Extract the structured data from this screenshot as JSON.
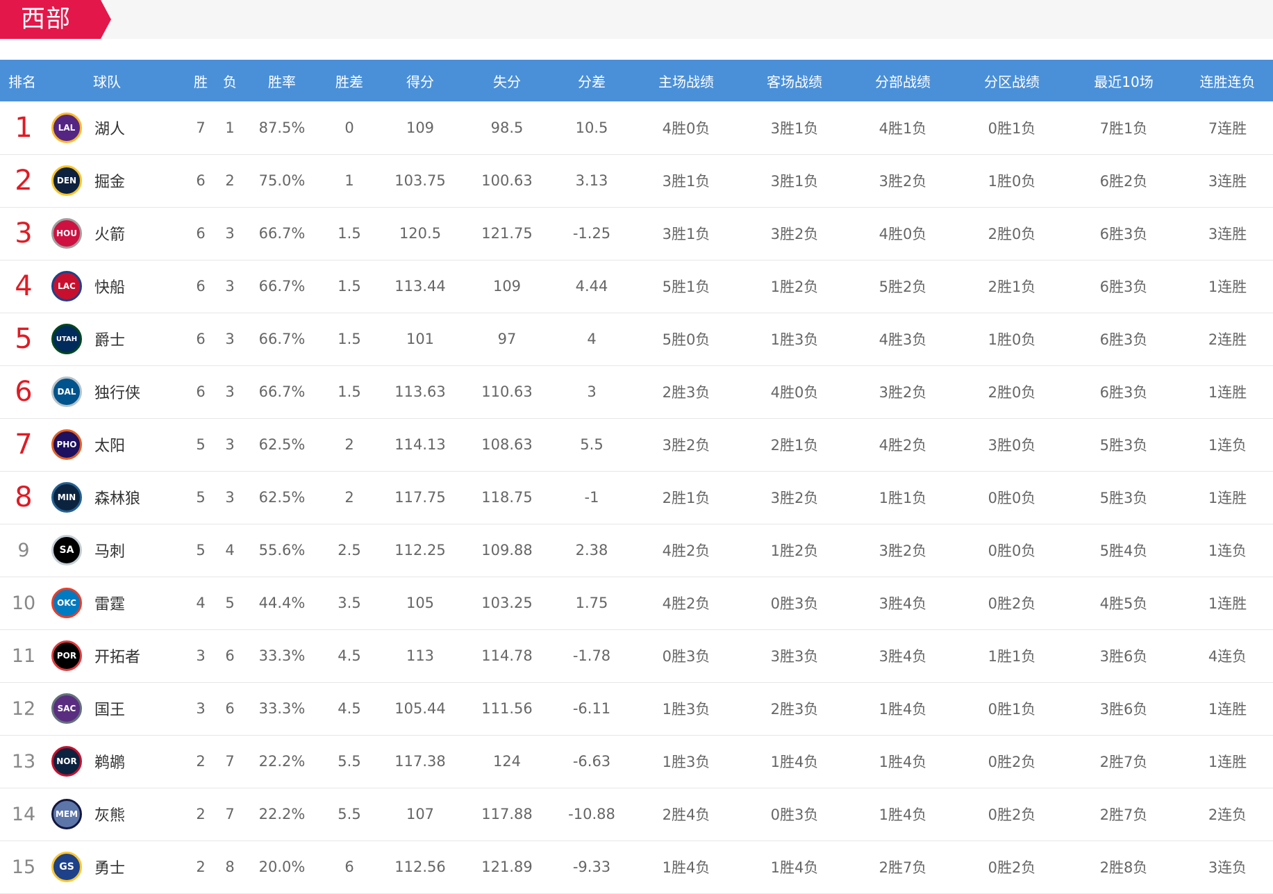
{
  "conference": {
    "label": "西部",
    "accent_color": "#e4174a"
  },
  "header_color": "#4a90d9",
  "columns": [
    "排名",
    "球队",
    "胜",
    "负",
    "胜率",
    "胜差",
    "得分",
    "失分",
    "分差",
    "主场战绩",
    "客场战绩",
    "分部战绩",
    "分区战绩",
    "最近10场",
    "连胜连负"
  ],
  "teams": [
    {
      "rank": "1",
      "logo": "LAL",
      "logo_color": "#552583",
      "logo_ring": "#fdb927",
      "name": "湖人",
      "w": "7",
      "l": "1",
      "pct": "87.5%",
      "gb": "0",
      "pf": "109",
      "pa": "98.5",
      "diff": "10.5",
      "home": "4胜0负",
      "away": "3胜1负",
      "div": "4胜1负",
      "conf": "0胜1负",
      "last10": "7胜1负",
      "streak": "7连胜"
    },
    {
      "rank": "2",
      "logo": "DEN",
      "logo_color": "#0e2240",
      "logo_ring": "#fec524",
      "name": "掘金",
      "w": "6",
      "l": "2",
      "pct": "75.0%",
      "gb": "1",
      "pf": "103.75",
      "pa": "100.63",
      "diff": "3.13",
      "home": "3胜1负",
      "away": "3胜1负",
      "div": "3胜2负",
      "conf": "1胜0负",
      "last10": "6胜2负",
      "streak": "3连胜"
    },
    {
      "rank": "3",
      "logo": "HOU",
      "logo_color": "#ce1141",
      "logo_ring": "#a0a0a0",
      "name": "火箭",
      "w": "6",
      "l": "3",
      "pct": "66.7%",
      "gb": "1.5",
      "pf": "120.5",
      "pa": "121.75",
      "diff": "-1.25",
      "home": "3胜1负",
      "away": "3胜2负",
      "div": "4胜0负",
      "conf": "2胜0负",
      "last10": "6胜3负",
      "streak": "3连胜"
    },
    {
      "rank": "4",
      "logo": "LAC",
      "logo_color": "#c8102e",
      "logo_ring": "#1d428a",
      "name": "快船",
      "w": "6",
      "l": "3",
      "pct": "66.7%",
      "gb": "1.5",
      "pf": "113.44",
      "pa": "109",
      "diff": "4.44",
      "home": "5胜1负",
      "away": "1胜2负",
      "div": "5胜2负",
      "conf": "2胜1负",
      "last10": "6胜3负",
      "streak": "1连胜"
    },
    {
      "rank": "5",
      "logo": "UTAH",
      "logo_color": "#002b5c",
      "logo_ring": "#00471b",
      "name": "爵士",
      "w": "6",
      "l": "3",
      "pct": "66.7%",
      "gb": "1.5",
      "pf": "101",
      "pa": "97",
      "diff": "4",
      "home": "5胜0负",
      "away": "1胜3负",
      "div": "4胜3负",
      "conf": "1胜0负",
      "last10": "6胜3负",
      "streak": "2连胜"
    },
    {
      "rank": "6",
      "logo": "DAL",
      "logo_color": "#00538c",
      "logo_ring": "#b8c4ca",
      "name": "独行侠",
      "w": "6",
      "l": "3",
      "pct": "66.7%",
      "gb": "1.5",
      "pf": "113.63",
      "pa": "110.63",
      "diff": "3",
      "home": "2胜3负",
      "away": "4胜0负",
      "div": "3胜2负",
      "conf": "2胜0负",
      "last10": "6胜3负",
      "streak": "1连胜"
    },
    {
      "rank": "7",
      "logo": "PHO",
      "logo_color": "#1d1160",
      "logo_ring": "#e56020",
      "name": "太阳",
      "w": "5",
      "l": "3",
      "pct": "62.5%",
      "gb": "2",
      "pf": "114.13",
      "pa": "108.63",
      "diff": "5.5",
      "home": "3胜2负",
      "away": "2胜1负",
      "div": "4胜2负",
      "conf": "3胜0负",
      "last10": "5胜3负",
      "streak": "1连负"
    },
    {
      "rank": "8",
      "logo": "MIN",
      "logo_color": "#0c2340",
      "logo_ring": "#236192",
      "name": "森林狼",
      "w": "5",
      "l": "3",
      "pct": "62.5%",
      "gb": "2",
      "pf": "117.75",
      "pa": "118.75",
      "diff": "-1",
      "home": "2胜1负",
      "away": "3胜2负",
      "div": "1胜1负",
      "conf": "0胜0负",
      "last10": "5胜3负",
      "streak": "1连胜"
    },
    {
      "rank": "9",
      "logo": "SA",
      "logo_color": "#000000",
      "logo_ring": "#c4ced4",
      "name": "马刺",
      "w": "5",
      "l": "4",
      "pct": "55.6%",
      "gb": "2.5",
      "pf": "112.25",
      "pa": "109.88",
      "diff": "2.38",
      "home": "4胜2负",
      "away": "1胜2负",
      "div": "3胜2负",
      "conf": "0胜0负",
      "last10": "5胜4负",
      "streak": "1连负"
    },
    {
      "rank": "10",
      "logo": "OKC",
      "logo_color": "#007ac1",
      "logo_ring": "#ef3b24",
      "name": "雷霆",
      "w": "4",
      "l": "5",
      "pct": "44.4%",
      "gb": "3.5",
      "pf": "105",
      "pa": "103.25",
      "diff": "1.75",
      "home": "4胜2负",
      "away": "0胜3负",
      "div": "3胜4负",
      "conf": "0胜2负",
      "last10": "4胜5负",
      "streak": "1连胜"
    },
    {
      "rank": "11",
      "logo": "POR",
      "logo_color": "#000000",
      "logo_ring": "#e03a3e",
      "name": "开拓者",
      "w": "3",
      "l": "6",
      "pct": "33.3%",
      "gb": "4.5",
      "pf": "113",
      "pa": "114.78",
      "diff": "-1.78",
      "home": "0胜3负",
      "away": "3胜3负",
      "div": "3胜4负",
      "conf": "1胜1负",
      "last10": "3胜6负",
      "streak": "4连负"
    },
    {
      "rank": "12",
      "logo": "SAC",
      "logo_color": "#5a2d81",
      "logo_ring": "#63727a",
      "name": "国王",
      "w": "3",
      "l": "6",
      "pct": "33.3%",
      "gb": "4.5",
      "pf": "105.44",
      "pa": "111.56",
      "diff": "-6.11",
      "home": "1胜3负",
      "away": "2胜3负",
      "div": "1胜4负",
      "conf": "0胜1负",
      "last10": "3胜6负",
      "streak": "1连胜"
    },
    {
      "rank": "13",
      "logo": "NOR",
      "logo_color": "#0c2340",
      "logo_ring": "#c8102e",
      "name": "鹈鹕",
      "w": "2",
      "l": "7",
      "pct": "22.2%",
      "gb": "5.5",
      "pf": "117.38",
      "pa": "124",
      "diff": "-6.63",
      "home": "1胜3负",
      "away": "1胜4负",
      "div": "1胜4负",
      "conf": "0胜2负",
      "last10": "2胜7负",
      "streak": "1连胜"
    },
    {
      "rank": "14",
      "logo": "MEM",
      "logo_color": "#5d76a9",
      "logo_ring": "#12173f",
      "name": "灰熊",
      "w": "2",
      "l": "7",
      "pct": "22.2%",
      "gb": "5.5",
      "pf": "107",
      "pa": "117.88",
      "diff": "-10.88",
      "home": "2胜4负",
      "away": "0胜3负",
      "div": "1胜4负",
      "conf": "0胜2负",
      "last10": "2胜7负",
      "streak": "2连负"
    },
    {
      "rank": "15",
      "logo": "GS",
      "logo_color": "#1d428a",
      "logo_ring": "#ffc72c",
      "name": "勇士",
      "w": "2",
      "l": "8",
      "pct": "20.0%",
      "gb": "6",
      "pf": "112.56",
      "pa": "121.89",
      "diff": "-9.33",
      "home": "1胜4负",
      "away": "1胜4负",
      "div": "2胜7负",
      "conf": "0胜2负",
      "last10": "2胜8负",
      "streak": "3连负"
    }
  ]
}
